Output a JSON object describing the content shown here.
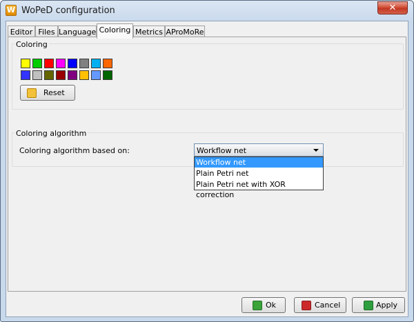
{
  "window": {
    "title": "WoPeD configuration",
    "app_icon_text": "W",
    "close_glyph": "✕"
  },
  "tabs": [
    {
      "label": "Editor",
      "active": false
    },
    {
      "label": "Files",
      "active": false
    },
    {
      "label": "Language",
      "active": false
    },
    {
      "label": "Coloring",
      "active": true
    },
    {
      "label": "Metrics",
      "active": false
    },
    {
      "label": "AProMoRe",
      "active": false
    }
  ],
  "coloring": {
    "title": "Coloring",
    "swatches_row1": [
      "#ffff00",
      "#00cc00",
      "#ff0000",
      "#ff00ff",
      "#0000ff",
      "#808080",
      "#00b0f0",
      "#ff6600"
    ],
    "swatches_row2": [
      "#3333ff",
      "#c0c0c0",
      "#666600",
      "#990000",
      "#800080",
      "#ffc000",
      "#6699ff",
      "#006600"
    ],
    "reset_label": "Reset",
    "reset_icon": "undo-arrow-icon"
  },
  "algorithm": {
    "title": "Coloring algorithm",
    "label": "Coloring algorithm based on:",
    "selected": "Workflow net",
    "options": [
      "Workflow net",
      "Plain Petri net",
      "Plain Petri net with XOR correction"
    ]
  },
  "footer": {
    "ok_label": "Ok",
    "cancel_label": "Cancel",
    "apply_label": "Apply",
    "ok_icon": "check-icon",
    "cancel_icon": "x-icon",
    "apply_icon": "download-arrow-icon"
  },
  "colors": {
    "accent": "#3399ff",
    "ok_green": "#3aa33a",
    "cancel_red": "#cc2a2a",
    "apply_green": "#2f9e3f"
  }
}
